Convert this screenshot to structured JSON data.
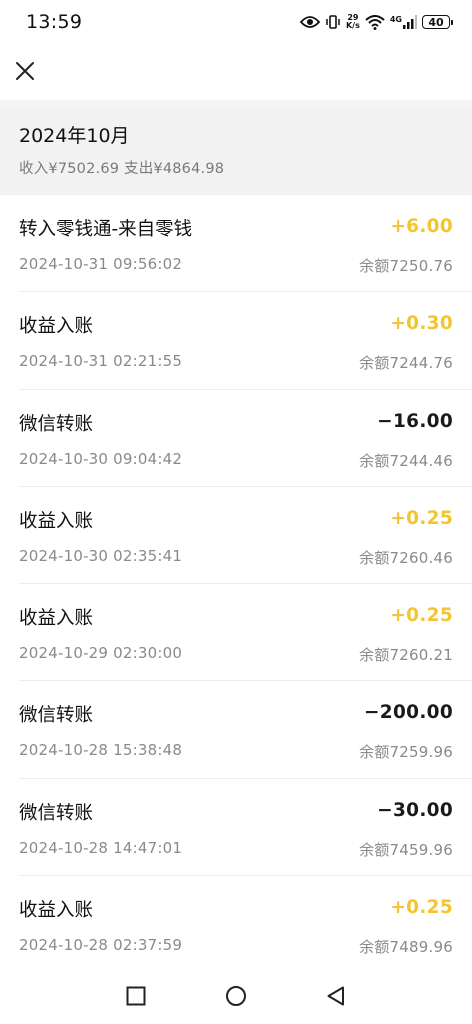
{
  "status_bar": {
    "time": "13:59",
    "net_speed_value": "29",
    "net_speed_unit": "K/s",
    "network_type": "4G",
    "battery": "40",
    "icons": [
      "eye-icon",
      "vibrate-icon",
      "wifi-icon",
      "signal-icon",
      "battery-icon"
    ]
  },
  "nav": {
    "close_icon": "close-icon"
  },
  "month": {
    "title": "2024年10月",
    "summary": "收入¥7502.69 支出¥4864.98"
  },
  "transactions": [
    {
      "title": "转入零钱通-来自零钱",
      "amount": "+6.00",
      "type": "income",
      "time": "2024-10-31 09:56:02",
      "balance": "余额7250.76"
    },
    {
      "title": "收益入账",
      "amount": "+0.30",
      "type": "income",
      "time": "2024-10-31 02:21:55",
      "balance": "余额7244.76"
    },
    {
      "title": "微信转账",
      "amount": "−16.00",
      "type": "expense",
      "time": "2024-10-30 09:04:42",
      "balance": "余额7244.46"
    },
    {
      "title": "收益入账",
      "amount": "+0.25",
      "type": "income",
      "time": "2024-10-30 02:35:41",
      "balance": "余额7260.46"
    },
    {
      "title": "收益入账",
      "amount": "+0.25",
      "type": "income",
      "time": "2024-10-29 02:30:00",
      "balance": "余额7260.21"
    },
    {
      "title": "微信转账",
      "amount": "−200.00",
      "type": "expense",
      "time": "2024-10-28 15:38:48",
      "balance": "余额7259.96"
    },
    {
      "title": "微信转账",
      "amount": "−30.00",
      "type": "expense",
      "time": "2024-10-28 14:47:01",
      "balance": "余额7459.96"
    },
    {
      "title": "收益入账",
      "amount": "+0.25",
      "type": "income",
      "time": "2024-10-28 02:37:59",
      "balance": "余额7489.96"
    }
  ],
  "colors": {
    "income": "#f2c531",
    "expense": "#1a1a1a",
    "header_bg": "#f2f2f2"
  },
  "android_nav": [
    "recents-square-icon",
    "home-circle-icon",
    "back-triangle-icon"
  ]
}
